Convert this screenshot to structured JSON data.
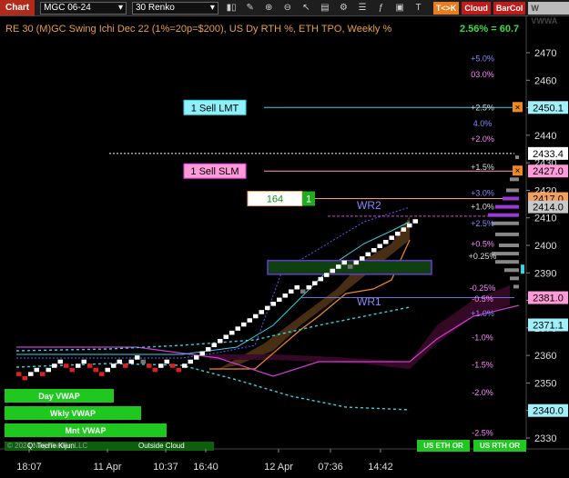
{
  "toolbar": {
    "title": "Chart",
    "instrument": "MGC 06-24",
    "bar_type": "30 Renko",
    "icons": [
      "bars-icon",
      "pencil-icon",
      "magnifier-plus-icon",
      "magnifier-minus-icon",
      "cursor-icon",
      "data-box-icon",
      "settings-icon",
      "list-icon",
      "indicator-icon",
      "lock-icon",
      "t-icon"
    ],
    "btn_tk": "T<>K",
    "btn_cloud": "Cloud",
    "btn_barcol": "BarCol",
    "btn_www": "W VWWA"
  },
  "header": {
    "text": "RE 30 (M)GC Swing Ichi Dec 22 (1%=20p=$200), US Dy RTH %, ETH TPO, Weekly %",
    "pct": "2.56% = 60.7"
  },
  "colors": {
    "title_orange": "#e8a23a",
    "green_up": "#3cdc3c",
    "red_down": "#e02020",
    "cyan": "#37d3e3",
    "magenta": "#e040e0",
    "purple": "#9a3ad6"
  },
  "y_axis": {
    "min": 2330,
    "max": 2480,
    "ticks": [
      2330,
      2340,
      2350,
      2360,
      2370,
      2380,
      2390,
      2400,
      2410,
      2420,
      2430,
      2440,
      2450,
      2460,
      2470
    ]
  },
  "price_tags": [
    {
      "price": "2450.1",
      "value": 2450.1,
      "bg": "#9ff0f8",
      "fg": "#000"
    },
    {
      "price": "2433.4",
      "value": 2433.4,
      "bg": "#ffffff",
      "fg": "#000"
    },
    {
      "price": "2427.0",
      "value": 2427.0,
      "bg": "#ff9ad8",
      "fg": "#000"
    },
    {
      "price": "2417.0",
      "value": 2417.0,
      "bg": "#f4a05c",
      "fg": "#000"
    },
    {
      "price": "2414.0",
      "value": 2414.0,
      "bg": "#c8c8c8",
      "fg": "#000"
    },
    {
      "price": "2381.0",
      "value": 2381.0,
      "bg": "#ff9ad8",
      "fg": "#000"
    },
    {
      "price": "2371.1",
      "value": 2371.1,
      "bg": "#9ff0f8",
      "fg": "#000"
    },
    {
      "price": "2340.0",
      "value": 2340.0,
      "bg": "#9ff0f8",
      "fg": "#000"
    }
  ],
  "orders": {
    "sell_lmt": "1 Sell LMT",
    "sell_slm": "1 Sell SLM",
    "position_qty": "164",
    "position_count": "1"
  },
  "pct_levels": [
    {
      "label": "+5.0%",
      "value": 2467.9,
      "color": "#8888ff"
    },
    {
      "label": "03.0%",
      "value": 2462.0,
      "color": "#ff88ff"
    },
    {
      "label": "+2.5%",
      "value": 2450.1,
      "color": "#dddddd"
    },
    {
      "label": "4.0%",
      "value": 2444.2,
      "color": "#8888ff"
    },
    {
      "label": "+2.0%",
      "value": 2438.7,
      "color": "#ff88ff"
    },
    {
      "label": "+1.5%",
      "value": 2428.4,
      "color": "#dddddd"
    },
    {
      "label": "+3.0%",
      "value": 2419.0,
      "color": "#8888ff"
    },
    {
      "label": "+1.0%",
      "value": 2414.0,
      "color": "#dddddd"
    },
    {
      "label": "+2.5%",
      "value": 2408.0,
      "color": "#8888ff"
    },
    {
      "label": "+0.5%",
      "value": 2400.5,
      "color": "#ff88ff"
    },
    {
      "label": "+0.25%",
      "value": 2396.0,
      "color": "#dddddd"
    },
    {
      "label": "-0.25%",
      "value": 2384.5,
      "color": "#ff88ff"
    },
    {
      "label": "-0.5%",
      "value": 2380.5,
      "color": "#ff88ff"
    },
    {
      "label": "+1.0%",
      "value": 2375.3,
      "color": "#8888ff"
    },
    {
      "label": "-1.0%",
      "value": 2366.5,
      "color": "#ff88ff"
    },
    {
      "label": "-1.5%",
      "value": 2356.5,
      "color": "#ff88ff"
    },
    {
      "label": "-2.0%",
      "value": 2346.5,
      "color": "#ff88ff"
    },
    {
      "label": "-2.5%",
      "value": 2331.8,
      "color": "#ff88ff"
    }
  ],
  "annotations": {
    "wr1": "WR1",
    "wr2": "WR2"
  },
  "vwap_buttons": [
    "Day VWAP",
    "Wkly VWAP",
    "Mnt VWAP"
  ],
  "bottom_labels": {
    "footer_left": "© 2024 NinjaTrader, LLC",
    "tricky": "Q: Teche Kijun",
    "outside_cloud": "Outside Cloud",
    "us_eth": "US ETH OR",
    "us_rth": "US RTH OR"
  },
  "x_axis": [
    "18:07",
    "11 Apr",
    "10:37",
    "16:40",
    "12 Apr",
    "07:36",
    "14:42"
  ]
}
